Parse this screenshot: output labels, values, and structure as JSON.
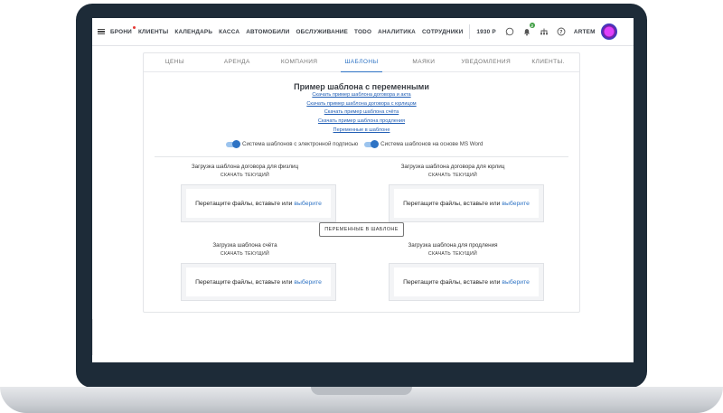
{
  "nav": {
    "items": [
      "БРОНИ",
      "КЛИЕНТЫ",
      "КАЛЕНДАРЬ",
      "КАССА",
      "АВТОМОБИЛИ",
      "ОБСЛУЖИВАНИЕ",
      "TODO",
      "АНАЛИТИКА",
      "СОТРУДНИКИ"
    ],
    "balance": "1930 Р",
    "notifications_count": "2",
    "user": "ARTEM"
  },
  "tabs": {
    "items": [
      "ЦЕНЫ",
      "АРЕНДА",
      "КОМПАНИЯ",
      "ШАБЛОНЫ",
      "МАЯКИ",
      "УВЕДОМЛЕНИЯ",
      "КЛИЕНТЫ."
    ],
    "active": "ШАБЛОНЫ"
  },
  "template": {
    "title": "Пример шаблона с переменными",
    "links": [
      "Скачать пример шаблона договора и акта",
      "Скачать пример шаблона договора с юрлицом",
      "Скачать пример шаблона счёта",
      "Скачать пример шаблона продления",
      "Переменные в шаблоне"
    ],
    "toggle_esign": "Система шаблонов с электронной подписью",
    "toggle_msword": "Система шаблонов на основе MS Word"
  },
  "uploads": {
    "download_current": "СКАЧАТЬ ТЕКУЩИЙ",
    "drop_text": "Перетащите файлы, вставьте или",
    "drop_link": "выберите",
    "individual": "Загрузка шаблона договора для физлиц",
    "legal": "Загрузка шаблона договора для юрлиц",
    "invoice": "Загрузка шаблона счёта",
    "extension": "Загрузка шаблона для продления",
    "variables_button": "ПЕРЕМЕННЫЕ В ШАБЛОНЕ"
  },
  "colors": {
    "accent": "#2e73c4",
    "laptop_frame": "#1d2b38"
  }
}
